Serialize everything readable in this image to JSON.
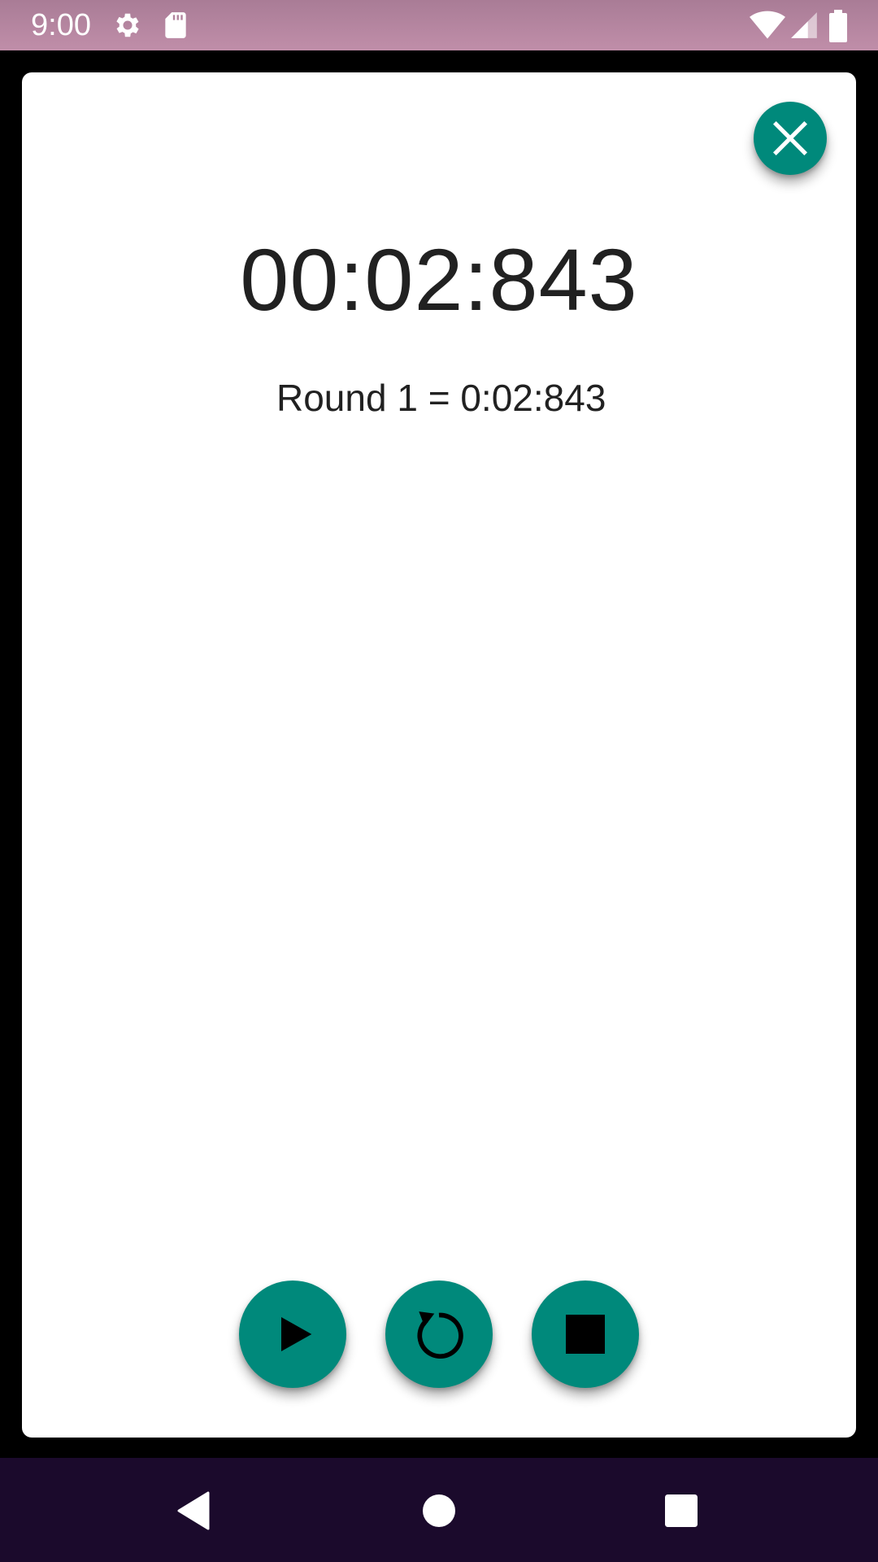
{
  "status_bar": {
    "time": "9:00",
    "icons": [
      "settings-icon",
      "sd-card-icon",
      "wifi-icon",
      "cell-signal-icon",
      "battery-icon"
    ]
  },
  "dialog": {
    "timer": "00:02:843",
    "rounds": [
      "Round 1 = 0:02:843"
    ],
    "close_icon": "close-icon"
  },
  "controls": [
    {
      "name": "play-button",
      "icon": "play-icon"
    },
    {
      "name": "reset-button",
      "icon": "reset-icon"
    },
    {
      "name": "stop-button",
      "icon": "stop-icon"
    }
  ],
  "nav": {
    "buttons": [
      "back-icon",
      "home-icon",
      "recents-icon"
    ]
  },
  "colors": {
    "accent": "#00897b",
    "status_bar": "#b88aa3",
    "nav_bar": "#1b0a2c"
  }
}
